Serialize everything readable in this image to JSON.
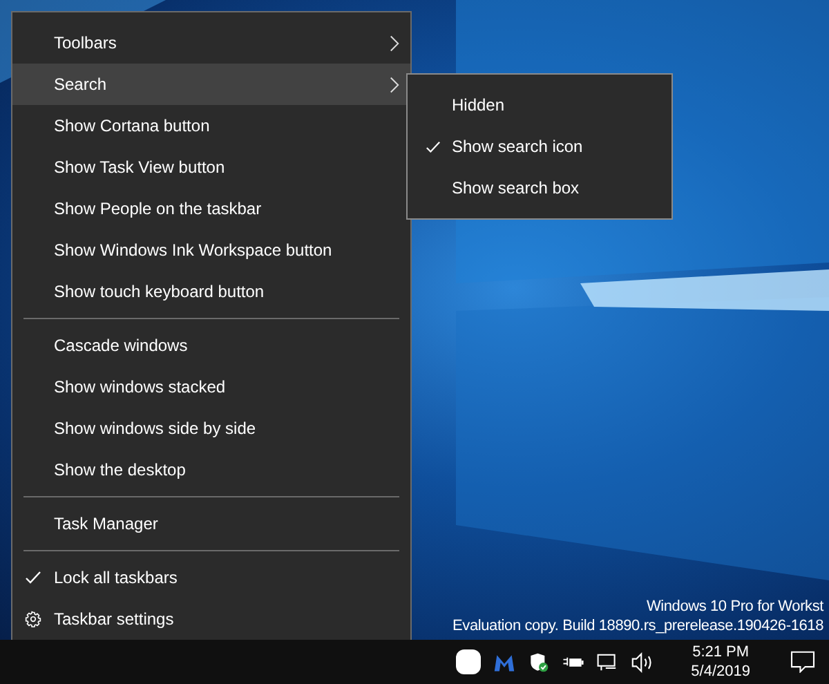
{
  "context_menu": {
    "items": [
      {
        "kind": "submenu",
        "label": "Toolbars",
        "selected": false,
        "checked": false
      },
      {
        "kind": "submenu",
        "label": "Search",
        "selected": true,
        "checked": false
      },
      {
        "kind": "item",
        "label": "Show Cortana button",
        "selected": false,
        "checked": false
      },
      {
        "kind": "item",
        "label": "Show Task View button",
        "selected": false,
        "checked": false
      },
      {
        "kind": "item",
        "label": "Show People on the taskbar",
        "selected": false,
        "checked": false
      },
      {
        "kind": "item",
        "label": "Show Windows Ink Workspace button",
        "selected": false,
        "checked": false
      },
      {
        "kind": "item",
        "label": "Show touch keyboard button",
        "selected": false,
        "checked": false
      },
      {
        "kind": "separator"
      },
      {
        "kind": "item",
        "label": "Cascade windows",
        "selected": false,
        "checked": false
      },
      {
        "kind": "item",
        "label": "Show windows stacked",
        "selected": false,
        "checked": false
      },
      {
        "kind": "item",
        "label": "Show windows side by side",
        "selected": false,
        "checked": false
      },
      {
        "kind": "item",
        "label": "Show the desktop",
        "selected": false,
        "checked": false
      },
      {
        "kind": "separator"
      },
      {
        "kind": "item",
        "label": "Task Manager",
        "selected": false,
        "checked": false
      },
      {
        "kind": "separator"
      },
      {
        "kind": "item",
        "label": "Lock all taskbars",
        "selected": false,
        "checked": true
      },
      {
        "kind": "settings",
        "label": "Taskbar settings",
        "selected": false,
        "checked": false
      }
    ]
  },
  "search_submenu": {
    "items": [
      {
        "label": "Hidden",
        "checked": false
      },
      {
        "label": "Show search icon",
        "checked": true
      },
      {
        "label": "Show search box",
        "checked": false
      }
    ]
  },
  "desktop_watermark": [
    "Windows 10 Pro for Workst",
    "Evaluation copy. Build 18890.rs_prerelease.190426-1618"
  ],
  "taskbar": {
    "time": "5:21 PM",
    "date": "5/4/2019"
  }
}
